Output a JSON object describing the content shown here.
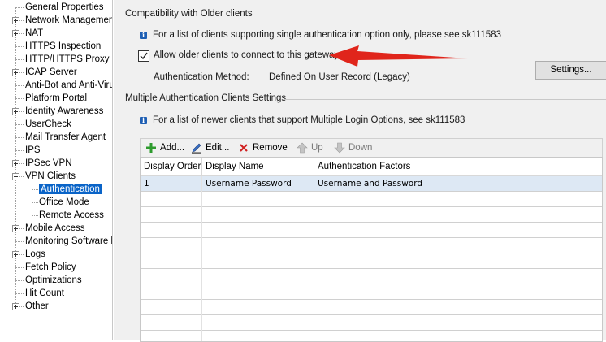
{
  "tree": {
    "items": [
      {
        "label": "General Properties",
        "expand": "none"
      },
      {
        "label": "Network Management",
        "expand": "plus"
      },
      {
        "label": "NAT",
        "expand": "plus"
      },
      {
        "label": "HTTPS Inspection",
        "expand": "none"
      },
      {
        "label": "HTTP/HTTPS Proxy",
        "expand": "none"
      },
      {
        "label": "ICAP Server",
        "expand": "plus"
      },
      {
        "label": "Anti-Bot and Anti-Virus",
        "expand": "none"
      },
      {
        "label": "Platform Portal",
        "expand": "none"
      },
      {
        "label": "Identity Awareness",
        "expand": "plus"
      },
      {
        "label": "UserCheck",
        "expand": "none"
      },
      {
        "label": "Mail Transfer Agent",
        "expand": "none"
      },
      {
        "label": "IPS",
        "expand": "none"
      },
      {
        "label": "IPSec VPN",
        "expand": "plus"
      },
      {
        "label": "VPN Clients",
        "expand": "minus"
      },
      {
        "label": "Authentication",
        "expand": "child",
        "selected": true
      },
      {
        "label": "Office Mode",
        "expand": "child"
      },
      {
        "label": "Remote Access",
        "expand": "child"
      },
      {
        "label": "Mobile Access",
        "expand": "plus"
      },
      {
        "label": "Monitoring Software bla",
        "expand": "none"
      },
      {
        "label": "Logs",
        "expand": "plus"
      },
      {
        "label": "Fetch Policy",
        "expand": "none"
      },
      {
        "label": "Optimizations",
        "expand": "none"
      },
      {
        "label": "Hit Count",
        "expand": "none"
      },
      {
        "label": "Other",
        "expand": "plus"
      }
    ]
  },
  "compat": {
    "title": "Compatibility with Older clients",
    "info": "For a list of clients supporting single authentication option only, please see sk111583",
    "checkbox_label": "Allow older clients to connect to this gateway",
    "checkbox_checked": true,
    "auth_method_label": "Authentication Method:",
    "auth_method_value": "Defined On User Record (Legacy)",
    "settings_button": "Settings..."
  },
  "multi": {
    "title": "Multiple Authentication Clients Settings",
    "info": "For a list of newer clients that support Multiple Login Options, see sk111583",
    "toolbar": {
      "add": "Add...",
      "edit": "Edit...",
      "remove": "Remove",
      "up": "Up",
      "down": "Down"
    },
    "columns": [
      "Display Order",
      "Display Name",
      "Authentication Factors"
    ],
    "rows": [
      [
        "1",
        "Username Password",
        "Username and Password"
      ]
    ]
  },
  "colors": {
    "selection": "#0a64c8",
    "arrow": "#e0251b",
    "row_highlight": "#dde8f4",
    "add_icon": "#2e9b2e",
    "remove_icon": "#d02020"
  },
  "icons": {
    "add": "plus-icon",
    "edit": "pencil-icon",
    "remove": "x-icon",
    "up": "arrow-up-icon",
    "down": "arrow-down-icon",
    "info": "info-icon"
  }
}
